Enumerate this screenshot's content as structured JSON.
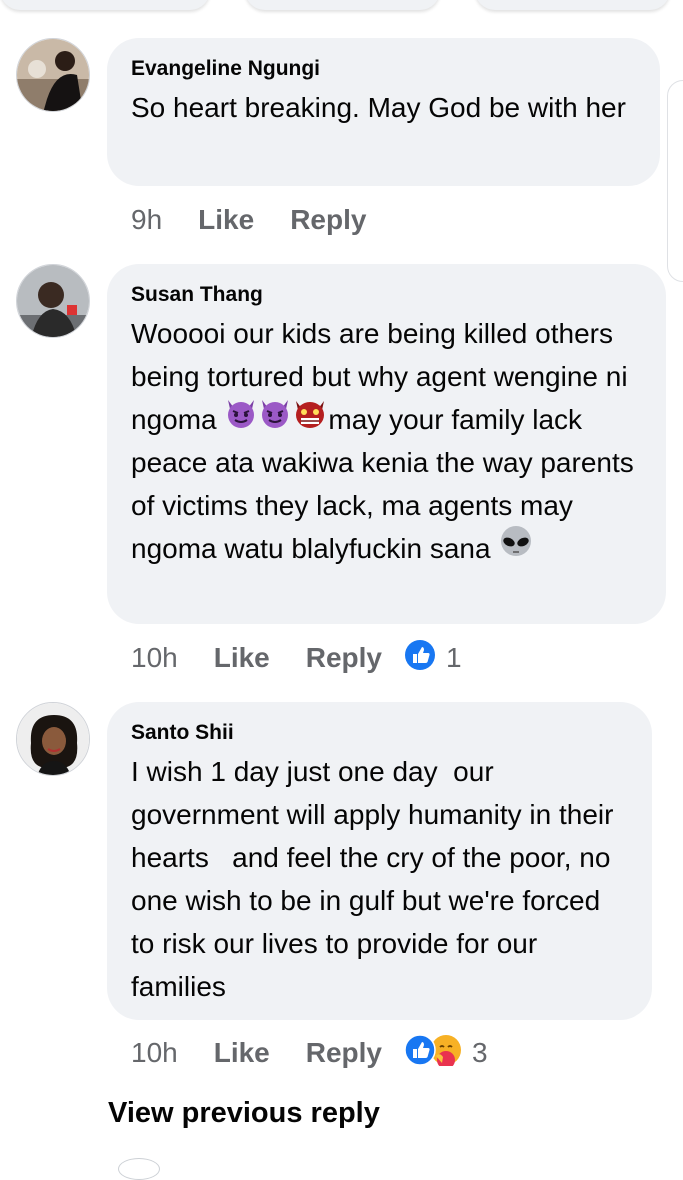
{
  "comments": [
    {
      "author": "Evangeline Ngungi",
      "text": "So heart breaking. May God be with her",
      "time": "9h",
      "like_label": "Like",
      "reply_label": "Reply"
    },
    {
      "author": "Susan Thang",
      "text_parts": [
        "Wooooi our kids are being killed others being tortured but why agent wengine ni ngoma ",
        "may your family lack peace ata wakiwa kenia the way parents of victims they lack, ma agents may ngoma watu blalyfuckin sana "
      ],
      "emoji_icons": [
        "smiling-imp-emoji",
        "smiling-imp-emoji",
        "ogre-mask-emoji",
        "alien-emoji"
      ],
      "time": "10h",
      "like_label": "Like",
      "reply_label": "Reply",
      "reaction_icons": [
        "like-reaction-icon"
      ],
      "reaction_count": "1"
    },
    {
      "author": "Santo Shii",
      "text": "I wish 1 day just one day  our government will apply humanity in their hearts   and feel the cry of the poor, no one wish to be in gulf but we're forced to risk our lives to provide for our families",
      "time": "10h",
      "like_label": "Like",
      "reply_label": "Reply",
      "reaction_icons": [
        "like-reaction-icon",
        "hug-reaction-icon"
      ],
      "reaction_count": "3"
    }
  ],
  "view_previous_label": "View previous reply",
  "colors": {
    "bubble_bg": "#f0f2f5",
    "meta_text": "#65676b",
    "like_blue": "#1877f2"
  }
}
